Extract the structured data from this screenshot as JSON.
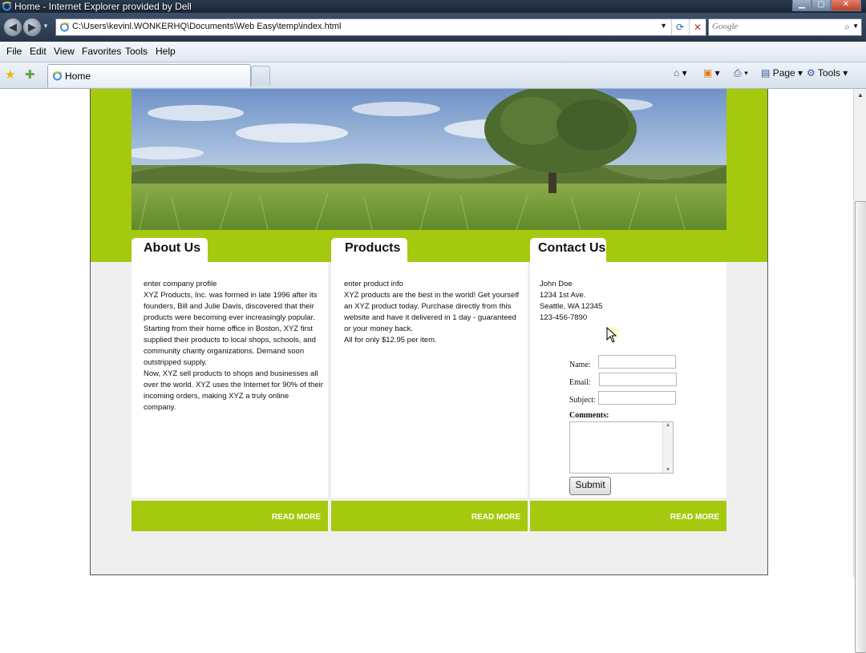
{
  "window": {
    "title": "Home - Internet Explorer provided by Dell",
    "controls": [
      "minimize",
      "maximize",
      "close"
    ]
  },
  "address_bar": {
    "url": "C:\\Users\\kevinl.WONKERHQ\\Documents\\Web Easy\\temp\\index.html",
    "search_placeholder": "Google"
  },
  "menu": [
    "File",
    "Edit",
    "View",
    "Favorites",
    "Tools",
    "Help"
  ],
  "tab": {
    "label": "Home"
  },
  "command_bar": {
    "page_label": "Page",
    "tools_label": "Tools"
  },
  "colors": {
    "accent_green": "#a5c90f",
    "page_background": "#efefef"
  },
  "page": {
    "columns": [
      {
        "heading": "About Us",
        "text": "enter company profile\nXYZ Products, Inc. was formed in late 1996 after its founders, Bill and Julie Davis, discovered that their products were becoming ever increasingly popular. Starting from their home office in Boston, XYZ first supplied their products to local shops, schools, and community charity organizations. Demand soon outstripped supply.\nNow, XYZ sell products to shops and businesses all over the world. XYZ uses the Internet for 90% of their incoming orders, making XYZ a truly online company.",
        "footer_link": "READ MORE"
      },
      {
        "heading": "Products",
        "text": "enter product info\nXYZ products are the best in the world! Get yourself an XYZ product today. Purchase directly from this website and have it delivered in 1 day - guaranteed or your money back.\nAll for only $12.95 per item.",
        "footer_link": "READ MORE"
      },
      {
        "heading": "Contact Us",
        "text": "John Doe\n1234 1st Ave.\nSeattle, WA 12345\n123-456-7890",
        "footer_link": "READ MORE"
      }
    ],
    "form": {
      "name_label": "Name:",
      "email_label": "Email:",
      "subject_label": "Subject:",
      "comments_label": "Comments:",
      "submit_label": "Submit"
    }
  }
}
